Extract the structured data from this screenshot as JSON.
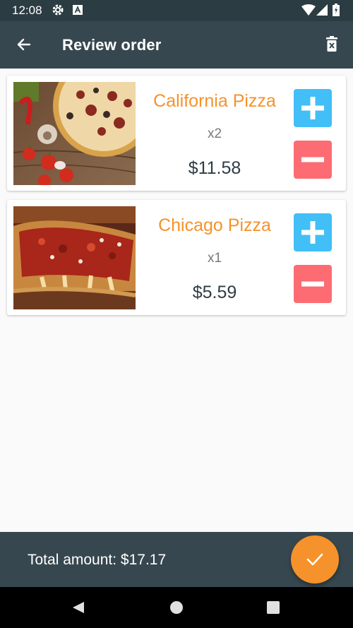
{
  "status_bar": {
    "time": "12:08",
    "icons": [
      "settings-icon",
      "a-badge-icon",
      "wifi-icon",
      "signal-icon",
      "battery-icon"
    ]
  },
  "app_bar": {
    "title": "Review order",
    "icons": [
      "back-arrow-icon",
      "trash-icon"
    ]
  },
  "items": [
    {
      "name": "California Pizza",
      "quantity": "x2",
      "price": "$11.58"
    },
    {
      "name": "Chicago Pizza",
      "quantity": "x1",
      "price": "$5.59"
    }
  ],
  "footer": {
    "total_text": "Total amount: $17.17"
  },
  "colors": {
    "primary_dark": "#2b3c42",
    "primary": "#37474f",
    "accent": "#f5922b",
    "plus_button": "#42bff6",
    "minus_button": "#fc6c72"
  }
}
